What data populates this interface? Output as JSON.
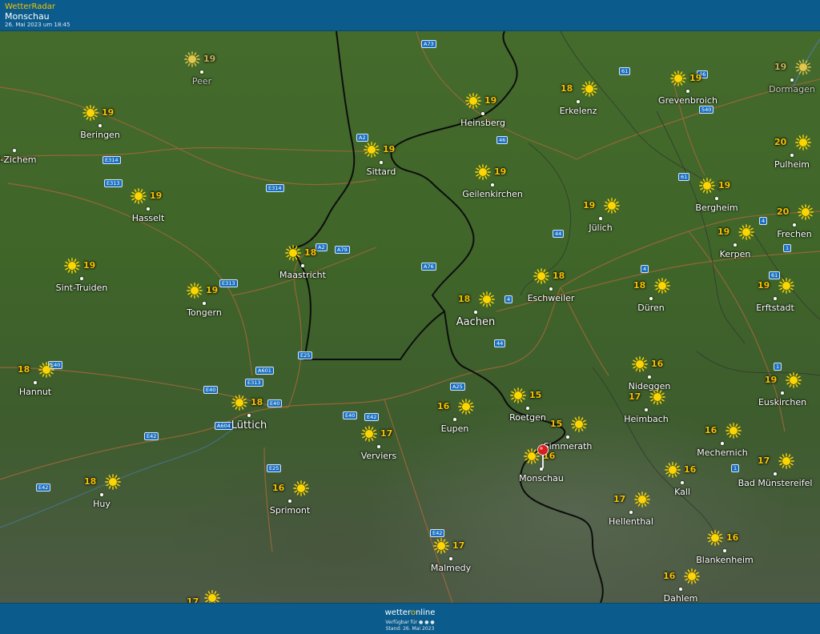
{
  "header": {
    "app_name": "WetterRadar",
    "location": "Monschau",
    "datetime": "26. Mai 2023 um 18:45"
  },
  "footer": {
    "brand_prefix": "wetter",
    "brand_o": "o",
    "brand_suffix": "nline",
    "available_label": "Verfügbar für",
    "stand": "Stand: 26. Mai 2023"
  },
  "colors": {
    "header_bg": "#0b5c8c",
    "temperature": "#f5c200",
    "sun": "#ffd500",
    "road_badge": "#1a6fc0",
    "border": "#111111",
    "pin": "#d81e1e"
  },
  "icons": {
    "weather": "sun-icon",
    "marker": "location-pin-icon",
    "platforms": [
      "apple-icon",
      "android-icon",
      "web-icon"
    ]
  },
  "places": [
    {
      "id": "peer",
      "name": "Peer",
      "temp": "19",
      "dim": true
    },
    {
      "id": "beringen",
      "name": "Beringen",
      "temp": "19"
    },
    {
      "id": "zichem",
      "name": "el-Zichem",
      "temp": ""
    },
    {
      "id": "hasselt",
      "name": "Hasselt",
      "temp": "19"
    },
    {
      "id": "sint-truiden",
      "name": "Sint-Truiden",
      "temp": "19"
    },
    {
      "id": "tongern",
      "name": "Tongern",
      "temp": "19"
    },
    {
      "id": "hannut",
      "name": "Hannut",
      "temp": "18"
    },
    {
      "id": "luettich",
      "name": "Lüttich",
      "temp": "18",
      "big": true
    },
    {
      "id": "huy",
      "name": "Huy",
      "temp": "18"
    },
    {
      "id": "sprimont",
      "name": "Sprimont",
      "temp": "16"
    },
    {
      "id": "verviers",
      "name": "Verviers",
      "temp": "17"
    },
    {
      "id": "eupen",
      "name": "Eupen",
      "temp": "16"
    },
    {
      "id": "malmedy",
      "name": "Malmedy",
      "temp": "17"
    },
    {
      "id": "maastricht",
      "name": "Maastricht",
      "temp": "18"
    },
    {
      "id": "sittard",
      "name": "Sittard",
      "temp": "19"
    },
    {
      "id": "heinsberg",
      "name": "Heinsberg",
      "temp": "19"
    },
    {
      "id": "geilenkirchen",
      "name": "Geilenkirchen",
      "temp": "19"
    },
    {
      "id": "erkelenz",
      "name": "Erkelenz",
      "temp": "18"
    },
    {
      "id": "aachen",
      "name": "Aachen",
      "temp": "18",
      "big": true
    },
    {
      "id": "eschweiler",
      "name": "Eschweiler",
      "temp": "18"
    },
    {
      "id": "juelich",
      "name": "Jülich",
      "temp": "19"
    },
    {
      "id": "roetgen",
      "name": "Roetgen",
      "temp": "15"
    },
    {
      "id": "simmerath",
      "name": "Simmerath",
      "temp": "15"
    },
    {
      "id": "monschau",
      "name": "Monschau",
      "temp": "16"
    },
    {
      "id": "grevenbroich",
      "name": "Grevenbroich",
      "temp": "19"
    },
    {
      "id": "dormagen",
      "name": "Dormagen",
      "temp": "19",
      "dim": true
    },
    {
      "id": "pulheim",
      "name": "Pulheim",
      "temp": "20"
    },
    {
      "id": "bergheim",
      "name": "Bergheim",
      "temp": "19"
    },
    {
      "id": "frechen",
      "name": "Frechen",
      "temp": "20"
    },
    {
      "id": "kerpen",
      "name": "Kerpen",
      "temp": "19"
    },
    {
      "id": "erftstadt",
      "name": "Erftstadt",
      "temp": "19"
    },
    {
      "id": "dueren",
      "name": "Düren",
      "temp": "18"
    },
    {
      "id": "nideggen",
      "name": "Nideggen",
      "temp": "16"
    },
    {
      "id": "heimbach",
      "name": "Heimbach",
      "temp": "17"
    },
    {
      "id": "euskirchen",
      "name": "Euskirchen",
      "temp": "19"
    },
    {
      "id": "mechernich",
      "name": "Mechernich",
      "temp": "16"
    },
    {
      "id": "kall",
      "name": "Kall",
      "temp": "16"
    },
    {
      "id": "bad-muenstereifel",
      "name": "Bad Münstereifel",
      "temp": "17"
    },
    {
      "id": "hellenthal",
      "name": "Hellenthal",
      "temp": "17"
    },
    {
      "id": "blankenheim",
      "name": "Blankenheim",
      "temp": "16"
    },
    {
      "id": "dahlem",
      "name": "Dahlem",
      "temp": "16"
    },
    {
      "id": "bottom-left",
      "name": "",
      "temp": "17"
    }
  ],
  "roads": [
    "A73",
    "61",
    "46",
    "540",
    "A2",
    "46",
    "E314",
    "E313",
    "E314",
    "61",
    "4",
    "44",
    "A2",
    "A79",
    "A76",
    "4",
    "1",
    "E313",
    "4",
    "61",
    "44",
    "E25",
    "E40",
    "A601",
    "E313",
    "E40",
    "A25",
    "E40",
    "E40",
    "E42",
    "A604",
    "E42",
    "1",
    "E25",
    "E42",
    "E42",
    "1"
  ]
}
